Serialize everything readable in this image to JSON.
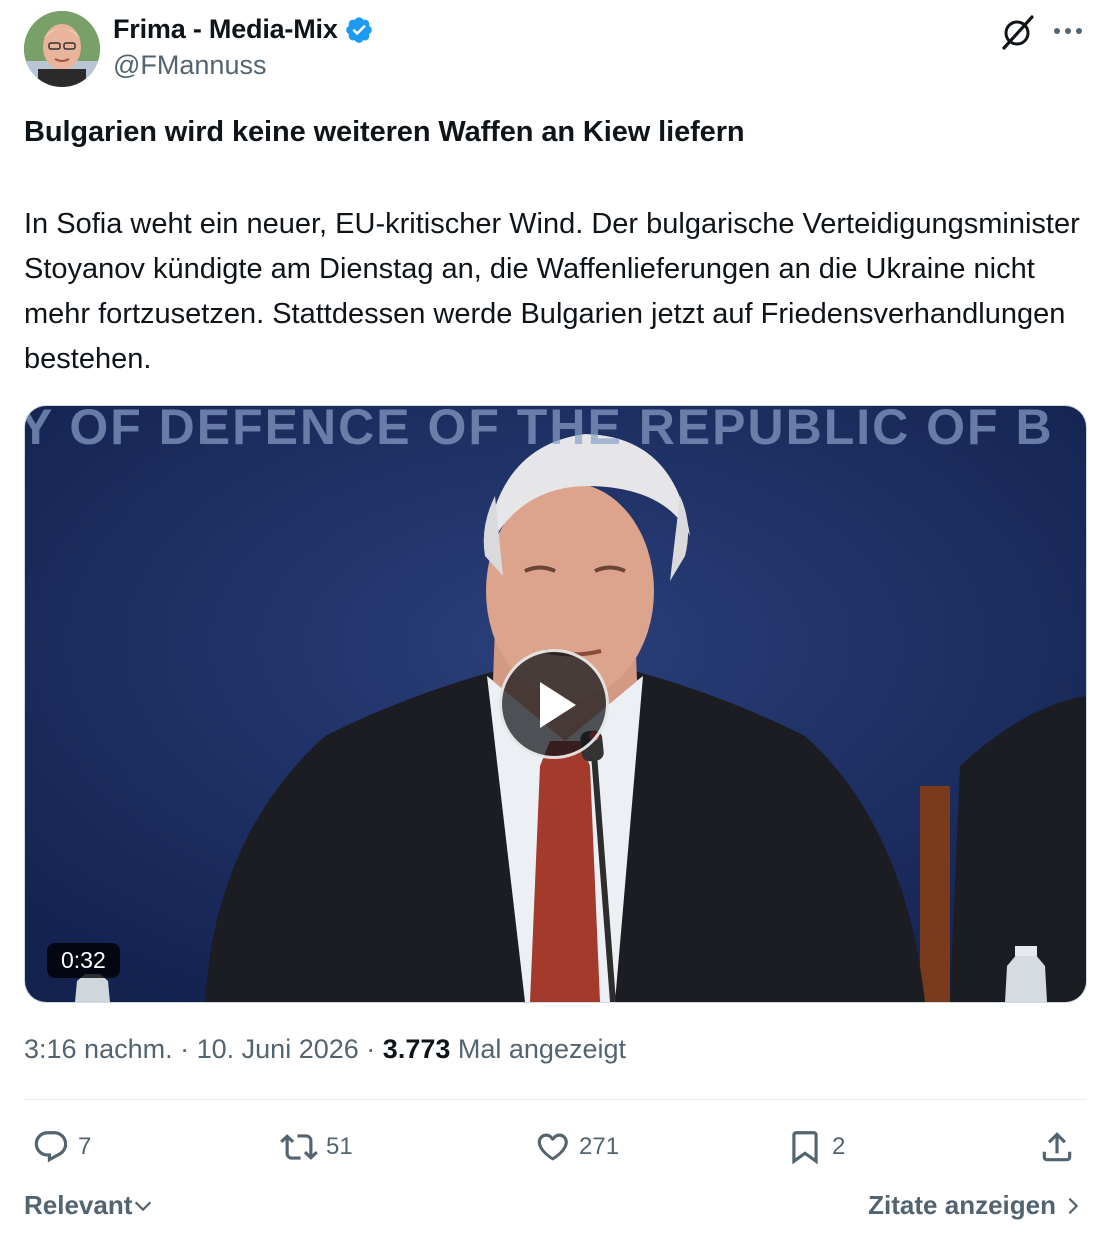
{
  "author": {
    "display_name": "Frima - Media-Mix",
    "handle": "@FMannuss",
    "verified": true
  },
  "post": {
    "headline": "Bulgarien wird keine weiteren Waffen an Kiew liefern",
    "body": "In Sofia weht ein neuer, EU-kritischer Wind. Der bulgarische Verteidigungsminister Stoyanov kündigte am Dienstag an, die Waffenlieferungen an die Ukraine nicht mehr fortzusetzen. Stattdessen werde Bulgarien jetzt auf Friedensverhandlungen bestehen."
  },
  "video": {
    "backdrop_text": "Y OF DEFENCE OF THE REPUBLIC OF B",
    "duration": "0:32"
  },
  "meta": {
    "time": "3:16 nachm.",
    "separator": "·",
    "date": "10. Juni 2026",
    "views": "3.773",
    "views_label": "Mal angezeigt"
  },
  "actions": {
    "replies": "7",
    "reposts": "51",
    "likes": "271",
    "bookmarks": "2"
  },
  "footer": {
    "sort_label": "Relevant",
    "quotes_label": "Zitate anzeigen"
  },
  "colors": {
    "verified_blue": "#1d9bf0",
    "secondary_text": "#536471",
    "primary_text": "#0f1419"
  }
}
